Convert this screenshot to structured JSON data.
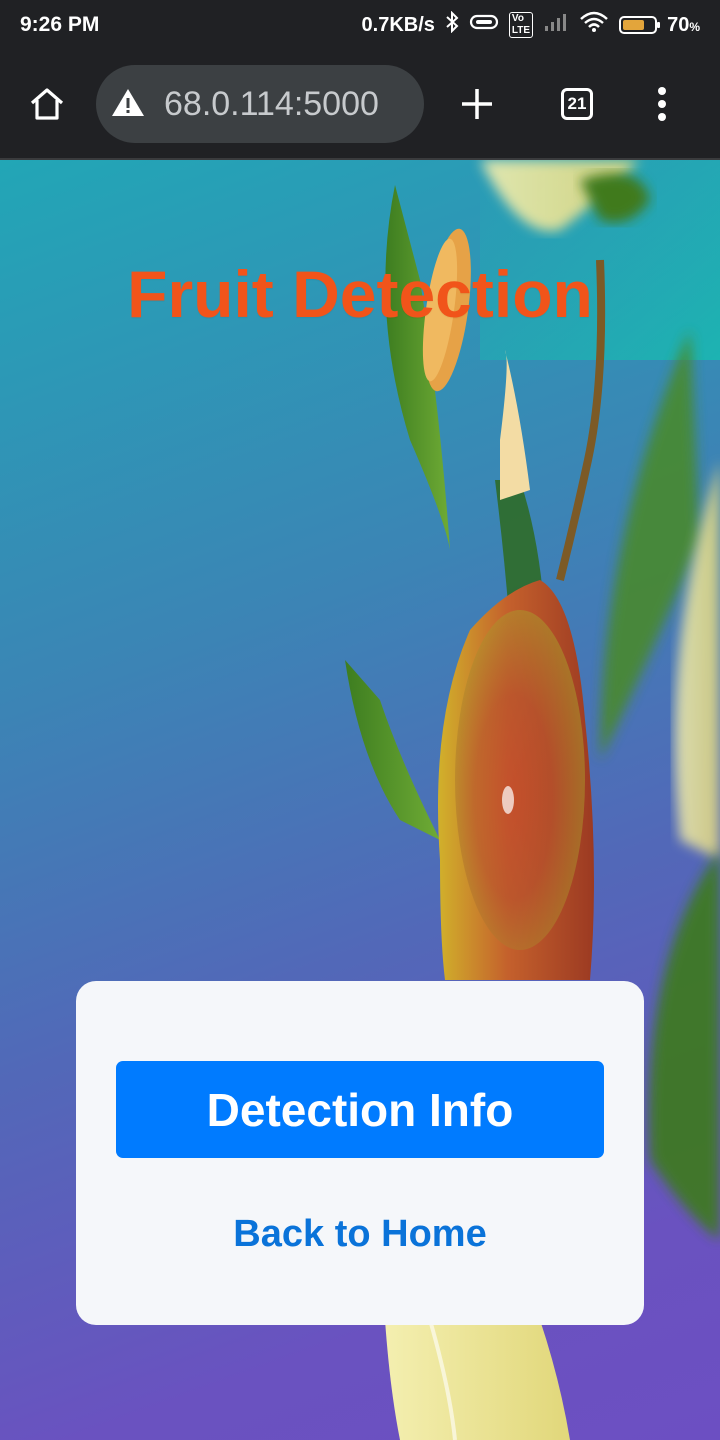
{
  "status_bar": {
    "time": "9:26 PM",
    "network_speed": "0.7KB/s",
    "volte_badge": "Vo LTE",
    "battery_percent": "70",
    "battery_unit": "%",
    "battery_level": 0.7,
    "icons": [
      "bluetooth-icon",
      "vibrate-icon",
      "volte-icon",
      "signal-icon",
      "wifi-icon",
      "battery-icon"
    ]
  },
  "browser": {
    "url": "68.0.114:5000",
    "security_icon": "warning-icon",
    "tab_count": "21",
    "icons": [
      "home-icon",
      "warning-icon",
      "plus-icon",
      "tabs-icon",
      "more-vert-icon"
    ]
  },
  "page": {
    "title": "Fruit Detection",
    "primary_button": "Detection Info",
    "secondary_link": "Back to Home",
    "colors": {
      "title": "#f1541a",
      "primary_button_bg": "#007bff",
      "link": "#0a73d9",
      "card_bg": "#f5f7fa"
    }
  }
}
